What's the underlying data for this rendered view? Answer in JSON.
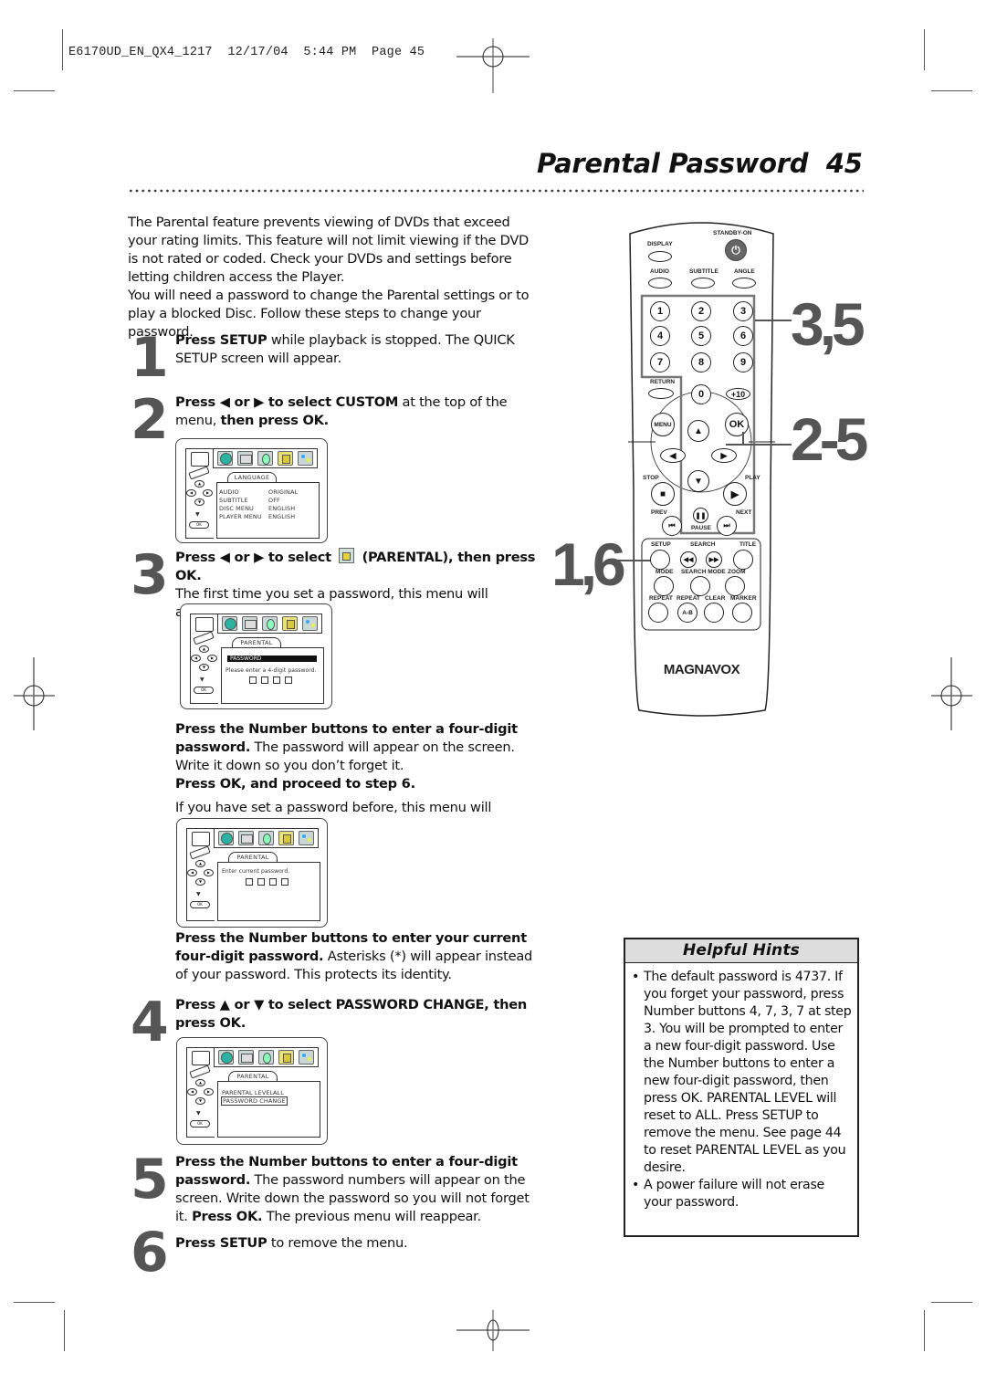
{
  "slug": "E6170UD_EN_QX4_1217  12/17/04  5:44 PM  Page 45",
  "header": {
    "title": "Parental Password",
    "page_number": "45"
  },
  "intro": [
    "The Parental feature prevents viewing of DVDs that exceed your rating limits. This feature will not limit viewing if the DVD is not rated or coded. Check your DVDs and settings before letting children access the Player.",
    "You will need a password to change the Parental settings or to play a blocked Disc. Follow these steps to change your password."
  ],
  "steps": {
    "s1": {
      "num": "1",
      "bold": "Press SETUP",
      "rest": " while playback is stopped. The QUICK SETUP screen will appear."
    },
    "s2": {
      "num": "2",
      "bold1": "Press ◀ or ▶ to select CUSTOM",
      "mid": " at the top of the menu, ",
      "bold2": "then press OK."
    },
    "s3": {
      "num": "3",
      "bold1": "Press ◀ or ▶ to select",
      "bold2": "(PARENTAL), then press OK.",
      "rest": "The first time you set a password, this menu will appear."
    },
    "s3b": {
      "bold": "Press the Number buttons to enter a four-digit password.",
      "rest": " The password will appear on the screen. Write it down so you don’t forget it.",
      "bold2": "Press OK, and proceed to step 6.",
      "rest2": "If you have set a password before, this menu will appear."
    },
    "s3c": {
      "bold": "Press the Number buttons to enter your current four-digit password.",
      "rest": " Asterisks (*) will appear instead of your password. This protects its identity."
    },
    "s4": {
      "num": "4",
      "bold": "Press ▲ or ▼ to select PASSWORD CHANGE, then press OK."
    },
    "s5": {
      "num": "5",
      "bold": "Press the Number buttons to enter a four-digit password.",
      "rest": " The password numbers will appear on the screen. Write down the password so you will not forget it. ",
      "bold2": "Press OK.",
      "rest2": " The previous menu will reappear."
    },
    "s6": {
      "num": "6",
      "bold": "Press SETUP",
      "rest": " to remove the menu."
    }
  },
  "osd_language": {
    "tab": "LANGUAGE",
    "rows": [
      {
        "label": "AUDIO",
        "value": "ORIGINAL"
      },
      {
        "label": "SUBTITLE",
        "value": "OFF"
      },
      {
        "label": "DISC MENU",
        "value": "ENGLISH"
      },
      {
        "label": "PLAYER MENU",
        "value": "ENGLISH"
      }
    ]
  },
  "osd_new_password": {
    "tab": "PARENTAL",
    "bar": "PASSWORD",
    "prompt": "Please  enter  a  4-digit  password."
  },
  "osd_current_password": {
    "tab": "PARENTAL",
    "prompt": "Enter  current  password."
  },
  "osd_parental_menu": {
    "tab": "PARENTAL",
    "level_label": "PARENTAL LEVEL",
    "level_value": "ALL",
    "password_change": "PASSWORD CHANGE"
  },
  "osd_icons": [
    "globe-icon",
    "screen-icon",
    "speaker-icon",
    "lock-icon",
    "preferences-icon"
  ],
  "osd_nav": {
    "ok": "OK"
  },
  "remote": {
    "brand": "MAGNAVOX",
    "labels": {
      "standby": "STANDBY-ON",
      "display": "DISPLAY",
      "audio": "AUDIO",
      "subtitle": "SUBTITLE",
      "angle": "ANGLE",
      "return": "RETURN",
      "menu": "MENU",
      "ok": "OK",
      "stop": "STOP",
      "play": "PLAY",
      "prev": "PREV",
      "next": "NEXT",
      "pause": "PAUSE",
      "setup": "SETUP",
      "search": "SEARCH",
      "title": "TITLE",
      "mode": "MODE",
      "search_mode": "SEARCH MODE",
      "zoom": "ZOOM",
      "repeat": "REPEAT",
      "repeat_ab": "REPEAT",
      "clear": "CLEAR",
      "marker": "MARKER",
      "ab": "A-B"
    },
    "numbers": [
      "1",
      "2",
      "3",
      "4",
      "5",
      "6",
      "7",
      "8",
      "9",
      "0",
      "+10"
    ],
    "callouts": {
      "c35": "3,5",
      "c25": "2-5",
      "c16": "1,6"
    }
  },
  "hints": {
    "title": "Helpful Hints",
    "items": [
      "The default password is 4737. If you forget your password, press Number buttons 4, 7, 3, 7 at step 3. You will be prompted to enter a new four-digit password. Use the Number buttons to enter a new four-digit password, then press OK. PARENTAL LEVEL will reset to ALL. Press SETUP to remove the menu. See page 44 to reset PARENTAL LEVEL as you desire.",
      "A power failure will not erase your password."
    ]
  }
}
